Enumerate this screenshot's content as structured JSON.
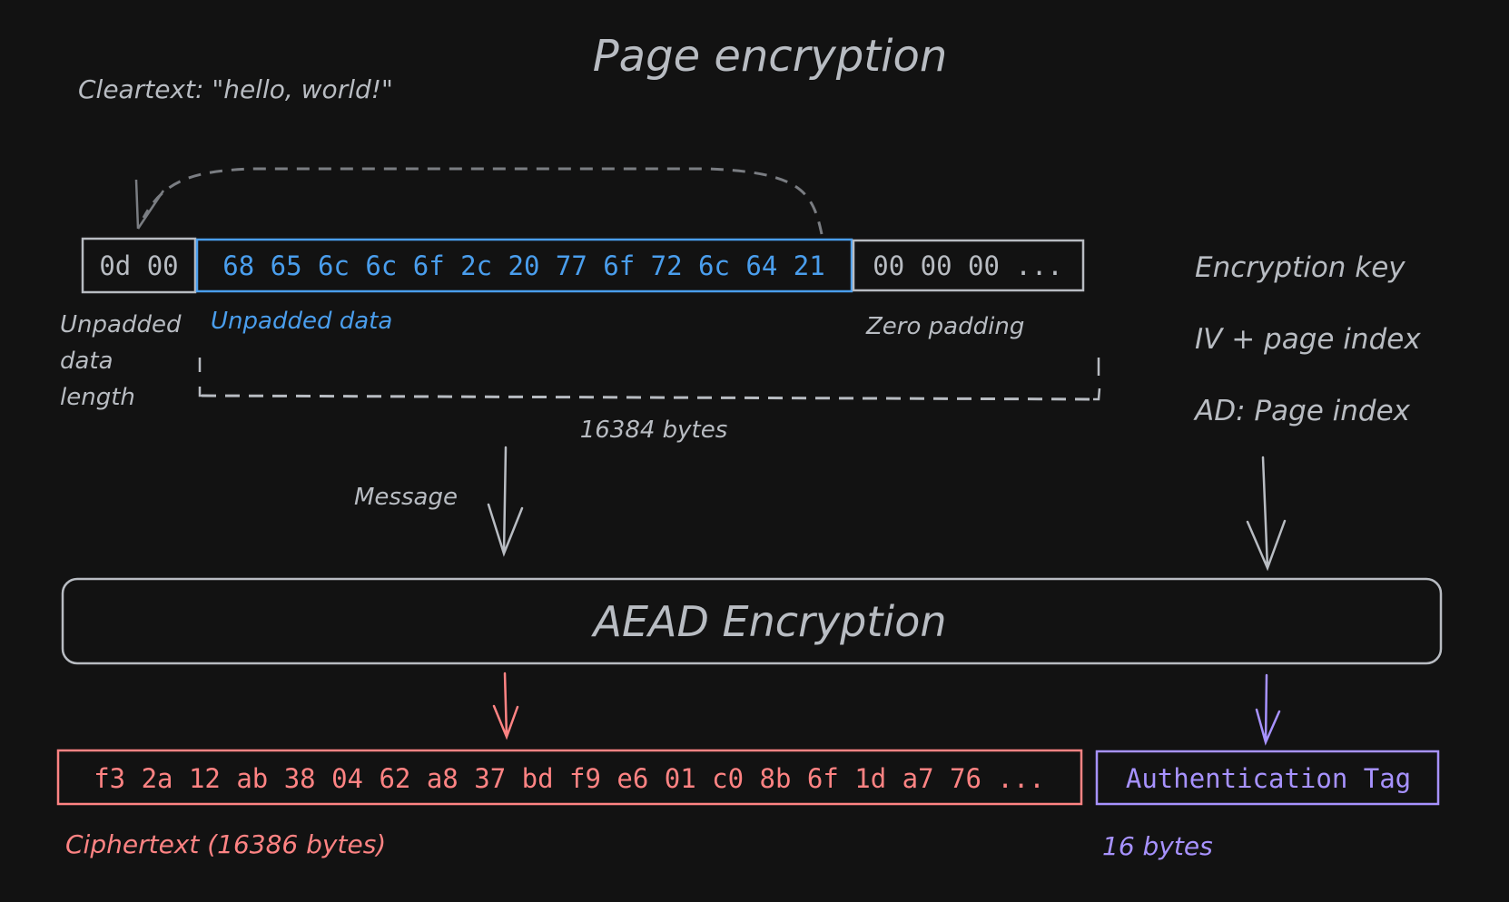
{
  "title": "Page encryption",
  "cleartext_label": "Cleartext: \"hello, world!\"",
  "row": {
    "length_bytes": "0d 00",
    "data_bytes": "68 65 6c 6c 6f 2c 20 77 6f 72 6c 64 21",
    "padding_bytes": "00 00 00 ..."
  },
  "labels": {
    "length_line1": "Unpadded",
    "length_line2": "data",
    "length_line3": "length",
    "unpadded_data": "Unpadded data",
    "zero_padding": "Zero padding",
    "total_size": "16384 bytes",
    "message": "Message"
  },
  "inputs": {
    "key": "Encryption key",
    "iv": "IV + page index",
    "ad": "AD: Page index"
  },
  "aead_label": "AEAD Encryption",
  "output": {
    "ciphertext_bytes": "f3 2a 12 ab 38 04 62 a8 37 bd f9 e6 01 c0 8b 6f 1d a7 76 ...",
    "ciphertext_label": "Ciphertext (16386 bytes)",
    "tag_text": "Authentication Tag",
    "tag_label": "16 bytes"
  },
  "colors": {
    "background": "#121212",
    "foreground": "#b8bcc2",
    "data_blue": "#4a9eed",
    "cipher_red": "#ff8383",
    "tag_purple": "#a792ff"
  }
}
